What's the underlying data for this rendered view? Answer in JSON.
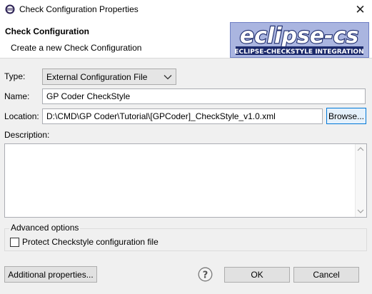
{
  "window": {
    "title": "Check Configuration Properties",
    "icons": {
      "app": "eclipse-app-icon",
      "close": "close-icon"
    },
    "close_glyph": "✕"
  },
  "header": {
    "title": "Check Configuration",
    "subtitle": "Create a new Check Configuration",
    "logo": {
      "main": "eclipse-cs",
      "tagline": "ECLIPSE-CHECKSTYLE INTEGRATION",
      "colors": {
        "text": "#ffffff",
        "outline": "#1c2a6b",
        "background": "#9aa8d9"
      }
    }
  },
  "form": {
    "type": {
      "label": "Type:",
      "value": "External Configuration File"
    },
    "name": {
      "label": "Name:",
      "value": "GP Coder CheckStyle"
    },
    "location": {
      "label": "Location:",
      "value": "D:\\CMD\\GP Coder\\Tutorial\\[GPCoder]_CheckStyle_v1.0.xml",
      "browse_label": "Browse..."
    },
    "description": {
      "label": "Description:",
      "value": ""
    }
  },
  "advanced": {
    "legend": "Advanced options",
    "protect_label": "Protect Checkstyle configuration file",
    "protect_checked": false
  },
  "footer": {
    "additional_label": "Additional properties...",
    "help_icon": "help-icon",
    "ok_label": "OK",
    "cancel_label": "Cancel"
  },
  "colors": {
    "accent": "#0078d7",
    "window_bg": "#f0f0f0"
  }
}
